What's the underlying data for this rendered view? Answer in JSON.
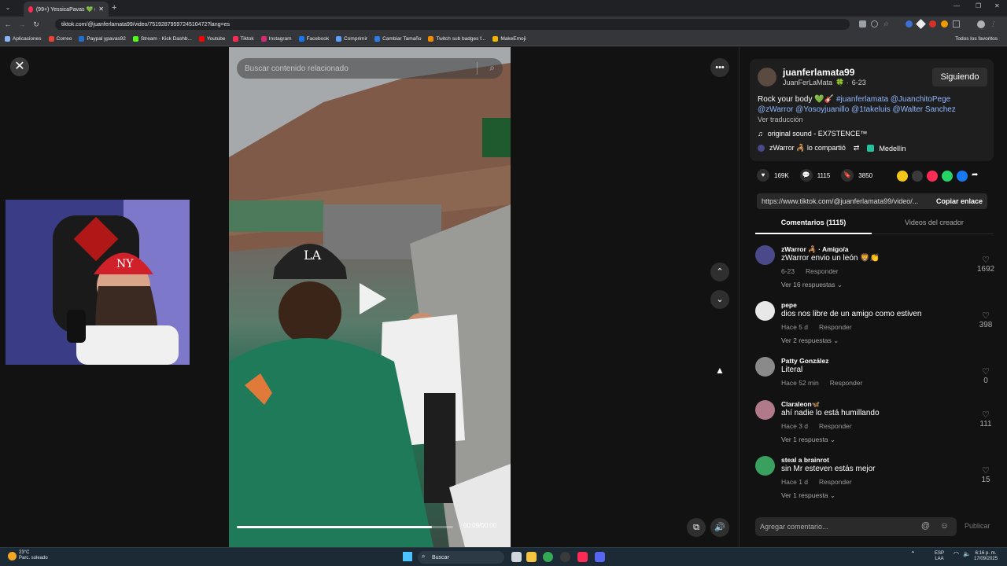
{
  "browser": {
    "tab_title": "(99+) YessicaPavas 💚 (@yessic",
    "url": "tiktok.com/@juanferlamata99/video/7519287959724510472?lang=es",
    "bookmarks": [
      {
        "label": "Aplicaciones",
        "color": "#8ab4f8"
      },
      {
        "label": "Correo",
        "color": "#ea4335"
      },
      {
        "label": "Paypal ypavas92",
        "color": "#1f6fd1"
      },
      {
        "label": "Stream - Kick Dashb...",
        "color": "#53fc18"
      },
      {
        "label": "Youtube",
        "color": "#ff0000"
      },
      {
        "label": "Tiktok",
        "color": "#fe2c55"
      },
      {
        "label": "Instagram",
        "color": "#d62976"
      },
      {
        "label": "Facebook",
        "color": "#1877f2"
      },
      {
        "label": "Comprimir",
        "color": "#5aa0ff"
      },
      {
        "label": "Cambiar Tamaño",
        "color": "#2b7de9"
      },
      {
        "label": "Twitch sub badges f...",
        "color": "#f28b00"
      },
      {
        "label": "MakeEmoji",
        "color": "#f4b400"
      }
    ],
    "all_favorites": "Todos los favoritos"
  },
  "video": {
    "search_placeholder": "Buscar contenido relacionado",
    "time": "00:09/00:00",
    "progress_fraction": 0.9
  },
  "post": {
    "username": "juanferlamata99",
    "display_name": "JuanFerLaMata",
    "date": "6-23",
    "follow_label": "Siguiendo",
    "caption_text": "Rock your body 💚🎸",
    "caption_tags": "#juanferlamata @JuanchitoPege @zWarror @Yosoyjuanillo @1takeluis @Walter Sanchez",
    "see_translation": "Ver traducción",
    "sound": "original sound - EX7STENCE™",
    "shared_by": "zWarror 🦂 lo compartió",
    "location": "Medellín",
    "likes": "169K",
    "comments_count": "1115",
    "saves": "3850",
    "link": "https://www.tiktok.com/@juanferlamata99/video/...",
    "copy_link": "Copiar enlace"
  },
  "tabs": {
    "comments": "Comentarios (1115)",
    "creator_videos": "Videos del creador"
  },
  "comments": [
    {
      "name": "zWarror 🦂 · Amigo/a",
      "text": "zWarror envio un león 🦁👏",
      "time": "6-23",
      "reply": "Responder",
      "replies": "Ver 16 respuestas ⌄",
      "likes": "1692",
      "avatar_color": "#4a4a8a"
    },
    {
      "name": "pepe",
      "text": "dios nos libre de un amigo como estiven",
      "time": "Hace 5 d",
      "reply": "Responder",
      "replies": "Ver 2 respuestas ⌄",
      "likes": "398",
      "avatar_color": "#e8e8e8"
    },
    {
      "name": "Patty González",
      "text": "Literal",
      "time": "Hace 52 min",
      "reply": "Responder",
      "replies": "",
      "likes": "0",
      "avatar_color": "#8a8a8a"
    },
    {
      "name": "Claraleon🦋",
      "text": "ahí nadie lo está humillando",
      "time": "Hace 3 d",
      "reply": "Responder",
      "replies": "Ver 1 respuesta ⌄",
      "likes": "111",
      "avatar_color": "#b07a8a"
    },
    {
      "name": "steal a brainrot",
      "text": "sin Mr esteven estás mejor",
      "time": "Hace 1 d",
      "reply": "Responder",
      "replies": "Ver 1 respuesta ⌄",
      "likes": "15",
      "avatar_color": "#3aa060"
    }
  ],
  "comment_box": {
    "placeholder": "Agregar comentario...",
    "publish": "Publicar"
  },
  "taskbar": {
    "temp": "23°C",
    "weather": "Parc. soleado",
    "search": "Buscar",
    "lang": "ESP",
    "lang2": "LAA",
    "time": "6:16 p. m.",
    "date": "17/09/2025"
  }
}
